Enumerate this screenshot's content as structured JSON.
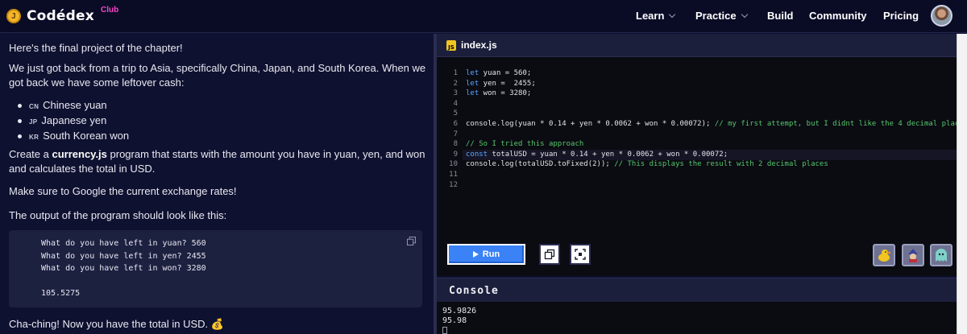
{
  "nav": {
    "logo_text": "Codédex",
    "logo_badge": "Club",
    "items": [
      "Learn",
      "Practice",
      "Build",
      "Community",
      "Pricing"
    ]
  },
  "lesson": {
    "intro": "Here's the final project of the chapter!",
    "trip_line1": "We just got back from a trip to Asia, specifically China, Japan, and South Korea. When we",
    "trip_line2": "got back we have some leftover cash:",
    "currencies": [
      {
        "flag": "CN",
        "label": "Chinese yuan"
      },
      {
        "flag": "JP",
        "label": "Japanese yen"
      },
      {
        "flag": "KR",
        "label": "South Korean won"
      }
    ],
    "create_pre": "Create a ",
    "create_file": "currency.js",
    "create_post": " program that starts with the amount you have in yuan, yen, and won",
    "create_line2": "and calculates the total in USD.",
    "google_line": "Make sure to Google the current exchange rates!",
    "output_line": "The output of the program should look like this:",
    "sample_output": [
      "What do you have left in yuan? 560",
      "What do you have left in yen? 2455",
      "What do you have left in won? 3280",
      "105.5275"
    ],
    "closing": "Cha-ching! Now you have the total in USD.",
    "closing_emoji": "💰"
  },
  "editor": {
    "filename": "index.js",
    "line_numbers": [
      "1",
      "2",
      "3",
      "4",
      "5",
      "6",
      "7",
      "8",
      "9",
      "10",
      "11",
      "12"
    ],
    "run_label": "Run"
  },
  "console": {
    "title": "Console",
    "lines": [
      "95.9826",
      "95.98"
    ]
  },
  "colors": {
    "background": "#0f1130",
    "accent_blue": "#3b82f6",
    "club_pink": "#f545c7",
    "comment_green": "#54c86a",
    "keyword_blue": "#57a8ff"
  }
}
